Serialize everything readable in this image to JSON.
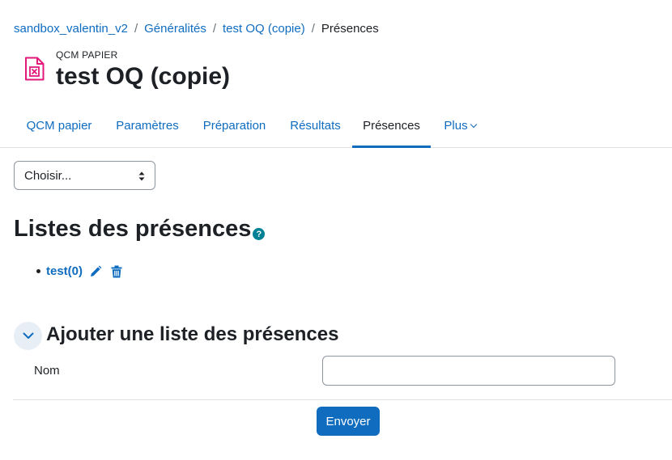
{
  "breadcrumb": {
    "items": [
      "sandbox_valentin_v2",
      "Généralités",
      "test OQ (copie)"
    ],
    "current": "Présences",
    "separator": "/"
  },
  "header": {
    "modname": "QCM PAPIER",
    "title": "test OQ (copie)",
    "icon": "qcm-paper-icon"
  },
  "tabs": [
    {
      "label": "QCM papier",
      "active": false
    },
    {
      "label": "Paramètres",
      "active": false
    },
    {
      "label": "Préparation",
      "active": false
    },
    {
      "label": "Résultats",
      "active": false
    },
    {
      "label": "Présences",
      "active": true
    },
    {
      "label": "Plus",
      "active": false
    }
  ],
  "select": {
    "value": "Choisir..."
  },
  "section": {
    "title": "Listes des présences",
    "help_icon": "question-icon"
  },
  "lists": [
    {
      "name": "test(0)",
      "edit_icon": "pencil-icon",
      "delete_icon": "trash-icon"
    }
  ],
  "form": {
    "title": "Ajouter une liste des présences",
    "field_label": "Nom",
    "field_value": "",
    "submit_label": "Envoyer"
  },
  "colors": {
    "link": "#0f6cbf",
    "primary": "#0f6cbf",
    "icon_pink": "#e2197b",
    "help": "#008196"
  }
}
